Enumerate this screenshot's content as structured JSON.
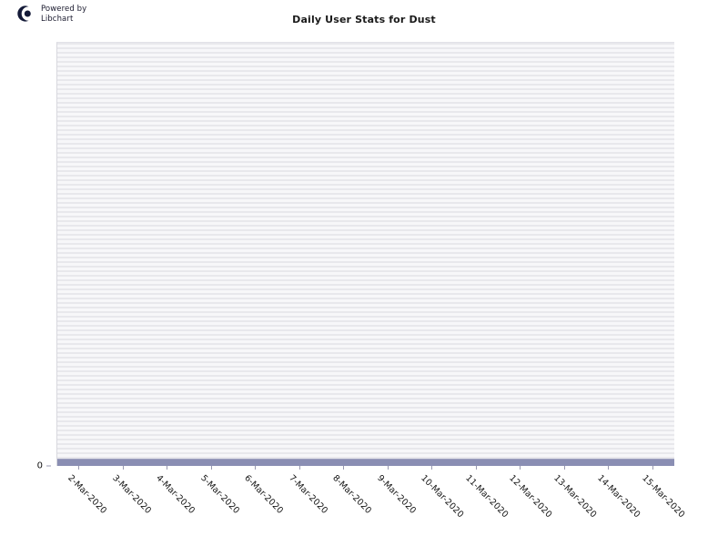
{
  "branding": {
    "logo_icon": "libchart-logo-icon",
    "text": "Powered by\nLibchart"
  },
  "chart_data": {
    "type": "bar",
    "title": "Daily User Stats for Dust",
    "xlabel": "",
    "ylabel": "",
    "grid": true,
    "legend": false,
    "legend_position": "none",
    "ylim": [
      0,
      1
    ],
    "y_ticks": [
      "0"
    ],
    "y_tick_values": [
      0
    ],
    "categories": [
      "2-Mar-2020",
      "3-Mar-2020",
      "4-Mar-2020",
      "5-Mar-2020",
      "6-Mar-2020",
      "7-Mar-2020",
      "8-Mar-2020",
      "9-Mar-2020",
      "10-Mar-2020",
      "11-Mar-2020",
      "12-Mar-2020",
      "13-Mar-2020",
      "14-Mar-2020",
      "15-Mar-2020"
    ],
    "values": [
      0,
      0,
      0,
      0,
      0,
      0,
      0,
      0,
      0,
      0,
      0,
      0,
      0,
      0
    ],
    "series_color": "#8a8eb3",
    "plot_stripe_color": "#e8e8ec",
    "plot_background": "#f7f7f9",
    "axis_color": "#9a9ab0",
    "text_color": "#111111"
  }
}
